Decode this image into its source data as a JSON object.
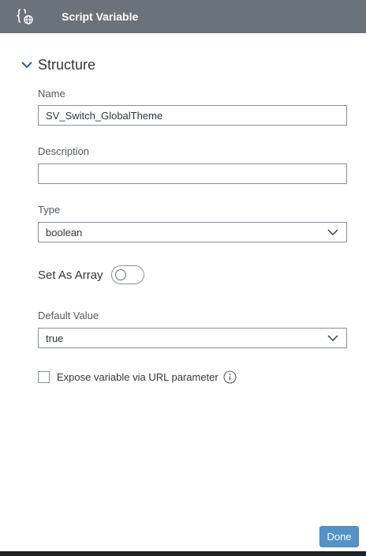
{
  "header": {
    "title": "Script Variable",
    "icon": "script-variable-icon"
  },
  "section": {
    "title": "Structure",
    "expanded": true
  },
  "fields": {
    "name": {
      "label": "Name",
      "value": "SV_Switch_GlobalTheme"
    },
    "description": {
      "label": "Description",
      "value": "",
      "placeholder": ""
    },
    "type": {
      "label": "Type",
      "value": "boolean"
    },
    "set_as_array": {
      "label": "Set As Array",
      "on": false
    },
    "default_value": {
      "label": "Default Value",
      "value": "true"
    },
    "expose_url": {
      "label": "Expose variable via URL parameter",
      "checked": false
    }
  },
  "footer": {
    "done_label": "Done"
  },
  "colors": {
    "header_bg": "#6a737b",
    "primary_button": "#5592c8",
    "input_border": "#89919a"
  }
}
